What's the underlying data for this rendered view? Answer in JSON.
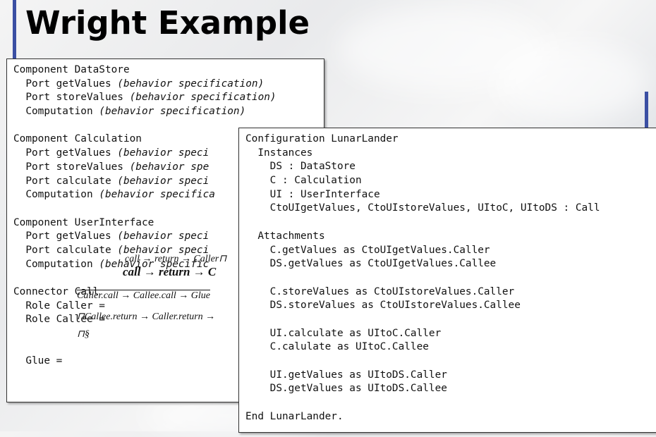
{
  "slide": {
    "title": "Wright Example"
  },
  "left_panel": {
    "lines": [
      {
        "code": "Component DataStore",
        "spec": ""
      },
      {
        "code": "  Port getValues ",
        "spec": "(behavior specification)"
      },
      {
        "code": "  Port storeValues ",
        "spec": "(behavior specification)"
      },
      {
        "code": "  Computation ",
        "spec": "(behavior specification)"
      },
      {
        "code": "",
        "spec": ""
      },
      {
        "code": "Component Calculation",
        "spec": ""
      },
      {
        "code": "  Port getValues ",
        "spec": "(behavior speci"
      },
      {
        "code": "  Port storeValues ",
        "spec": "(behavior spe"
      },
      {
        "code": "  Port calculate ",
        "spec": "(behavior speci"
      },
      {
        "code": "  Computation ",
        "spec": "(behavior specifica"
      },
      {
        "code": "",
        "spec": ""
      },
      {
        "code": "Component UserInterface",
        "spec": ""
      },
      {
        "code": "  Port getValues ",
        "spec": "(behavior speci"
      },
      {
        "code": "  Port calculate ",
        "spec": "(behavior speci"
      },
      {
        "code": "  Computation ",
        "spec": "(behavior specific"
      },
      {
        "code": "",
        "spec": ""
      },
      {
        "code": "Connector Call",
        "spec": ""
      },
      {
        "code": "  Role Caller =",
        "spec": ""
      },
      {
        "code": "  Role Callee =",
        "spec": ""
      },
      {
        "code": "",
        "spec": ""
      },
      {
        "code": "",
        "spec": ""
      },
      {
        "code": "  Glue =",
        "spec": ""
      }
    ],
    "formulas": {
      "caller_small": "call → return → Caller⊓",
      "caller_bold": "call → return → C",
      "glue": "Caller.call → Callee.call → Glue",
      "callee": "⊓Callee.return → Caller.return →",
      "tick": "⊓§"
    }
  },
  "right_panel": {
    "lines": [
      "Configuration LunarLander",
      "  Instances",
      "    DS : DataStore",
      "    C : Calculation",
      "    UI : UserInterface",
      "    CtoUIgetValues, CtoUIstoreValues, UItoC, UItoDS : Call",
      "",
      "  Attachments",
      "    C.getValues as CtoUIgetValues.Caller",
      "    DS.getValues as CtoUIgetValues.Callee",
      "",
      "    C.storeValues as CtoUIstoreValues.Caller",
      "    DS.storeValues as CtoUIstoreValues.Callee",
      "",
      "    UI.calculate as UItoC.Caller",
      "    C.calulate as UItoC.Callee",
      "",
      "    UI.getValues as UItoDS.Caller",
      "    DS.getValues as UItoDS.Callee",
      "",
      "End LunarLander."
    ]
  }
}
